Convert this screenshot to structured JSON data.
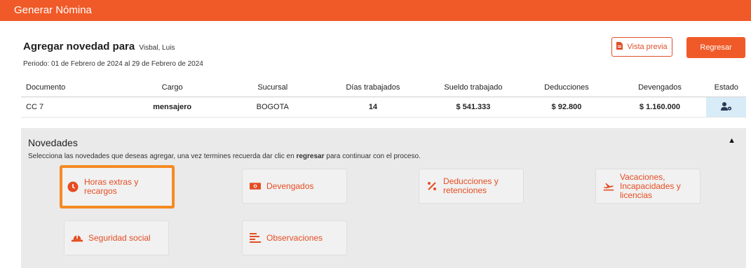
{
  "app": {
    "title": "Generar Nómina"
  },
  "header": {
    "title": "Agregar novedad para",
    "employee_name": "Visbal, Luis",
    "period": "Periodo: 01 de Febrero de 2024 al 29 de Febrero de 2024"
  },
  "actions": {
    "preview_label": "Vista previa",
    "back_label": "Regresar"
  },
  "table": {
    "headers": [
      "Documento",
      "Cargo",
      "Sucursal",
      "Días trabajados",
      "Sueldo trabajado",
      "Deducciones",
      "Devengados",
      "Estado"
    ],
    "row": {
      "documento": "CC 7",
      "cargo": "mensajero",
      "sucursal": "BOGOTA",
      "dias": "14",
      "sueldo": "$ 541.333",
      "deducciones": "$ 92.800",
      "devengados": "$ 1.160.000"
    }
  },
  "panel": {
    "title": "Novedades",
    "desc_before": "Selecciona las novedades que deseas agregar, una vez termines recuerda dar clic en ",
    "desc_bold": "regresar",
    "desc_after": " para continuar con el proceso.",
    "toggle_icon": "caret-up-icon",
    "tiles": [
      {
        "label": "Horas extras y recargos",
        "icon": "clock-icon",
        "selected": true
      },
      {
        "label": "Devengados",
        "icon": "money-icon"
      },
      {
        "label": "Deducciones y retenciones",
        "icon": "percent-icon"
      },
      {
        "label": "Vacaciones, Incapacidades y licencias",
        "icon": "plane-icon"
      },
      {
        "label": "Seguridad social",
        "icon": "hardhat-icon"
      },
      {
        "label": "Observaciones",
        "icon": "list-icon"
      }
    ]
  },
  "colors": {
    "brand": "#f05a28",
    "tile_text": "#e54d22",
    "selected_border": "#f58a23",
    "estado_bg": "#d8ecf8"
  }
}
